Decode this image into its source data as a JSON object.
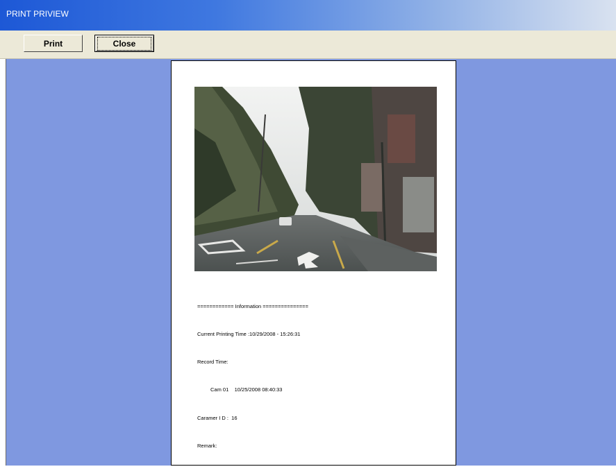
{
  "window": {
    "title": "PRINT PRIVIEW"
  },
  "toolbar": {
    "print_label": "Print",
    "close_label": "Close"
  },
  "document": {
    "info_header": "============ Information ===============",
    "current_printing_time": "Current Printing Time :10/29/2008 - 15:26:31",
    "record_time_label": "Record Time:",
    "record_entry": "Cam 01    10/25/2008 08:40:33",
    "camera_id": "Caramer I D :  16",
    "remark": "Remark:"
  },
  "colors": {
    "title_gradient_start": "#1d58d6",
    "viewport_bg": "#7f98e0",
    "toolbar_bg": "#ece9d8"
  }
}
